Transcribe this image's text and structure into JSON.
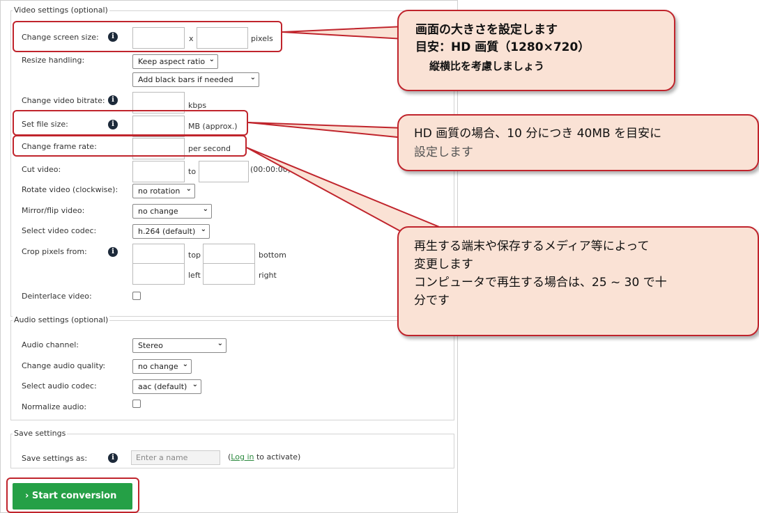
{
  "video_settings": {
    "legend": "Video settings (optional)",
    "screen_size": {
      "label": "Change screen size:",
      "sep": "x",
      "unit": "pixels",
      "width": "",
      "height": ""
    },
    "resize": {
      "label": "Resize handling:",
      "option1": "Keep aspect ratio",
      "option2": "Add black bars if needed"
    },
    "bitrate": {
      "label": "Change video bitrate:",
      "unit": "kbps"
    },
    "file_size": {
      "label": "Set file size:",
      "unit": "MB (approx.)"
    },
    "frame_rate": {
      "label": "Change frame rate:",
      "unit": "per second"
    },
    "cut": {
      "label": "Cut video:",
      "to": "to",
      "format": "(00:00:00)"
    },
    "rotate": {
      "label": "Rotate video (clockwise):",
      "value": "no rotation"
    },
    "mirror": {
      "label": "Mirror/flip video:",
      "value": "no change"
    },
    "codec": {
      "label": "Select video codec:",
      "value": "h.264 (default)"
    },
    "crop": {
      "label": "Crop pixels from:",
      "top": "top",
      "bottom": "bottom",
      "left": "left",
      "right": "right"
    },
    "deinterlace": {
      "label": "Deinterlace video:"
    }
  },
  "audio_settings": {
    "legend": "Audio settings (optional)",
    "channel": {
      "label": "Audio channel:",
      "value": "Stereo"
    },
    "quality": {
      "label": "Change audio quality:",
      "value": "no change"
    },
    "codec": {
      "label": "Select audio codec:",
      "value": "aac (default)"
    },
    "normalize": {
      "label": "Normalize audio:"
    }
  },
  "save_settings": {
    "legend": "Save settings",
    "label": "Save settings as:",
    "placeholder": "Enter a name",
    "login_pre": "(",
    "login_link": "Log in",
    "login_post": " to activate)"
  },
  "start_button": "› Start conversion",
  "callouts": {
    "c1": {
      "line1": "画面の大きさを設定します",
      "line2": "目安：HD 画質（1280×720）",
      "line3": "縦横比を考慮しましょう"
    },
    "c2": {
      "line1": "HD 画質の場合、10 分につき 40MB を目安に",
      "line2": "設定します"
    },
    "c3": {
      "line1": "再生する端末や保存するメディア等によって",
      "line2": "変更します",
      "line3": "コンピュータで再生する場合は、25 ~ 30 で十",
      "line4": "分です"
    }
  },
  "colors": {
    "accent_red": "#c0242c",
    "callout_bg": "#fae2d5",
    "button_green": "#25a046",
    "link_green": "#2b8a3e"
  },
  "icons": {
    "info": "info-icon",
    "chevron": "chevron-down-icon"
  }
}
